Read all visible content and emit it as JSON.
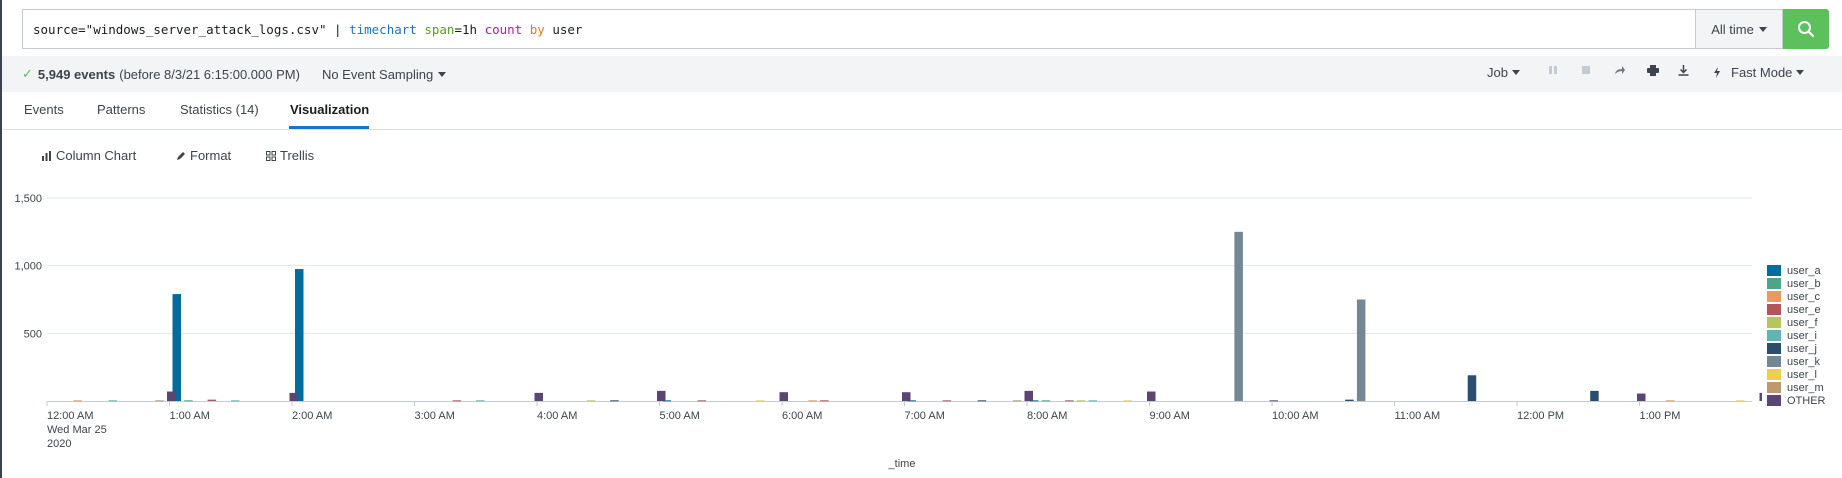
{
  "search": {
    "tokens": [
      {
        "text": "source=\"windows_server_attack_logs.csv\" | ",
        "cls": "tok-plain"
      },
      {
        "text": "timechart",
        "cls": "tok-cmd"
      },
      {
        "text": " ",
        "cls": "tok-plain"
      },
      {
        "text": "span",
        "cls": "tok-arg"
      },
      {
        "text": "=1h ",
        "cls": "tok-plain"
      },
      {
        "text": "count",
        "cls": "tok-fn"
      },
      {
        "text": " ",
        "cls": "tok-plain"
      },
      {
        "text": "by",
        "cls": "tok-kw"
      },
      {
        "text": " user",
        "cls": "tok-plain"
      }
    ],
    "time_range": "All time",
    "search_button_icon": "search-icon"
  },
  "status": {
    "check_icon": "✓",
    "events_count": "5,949 events",
    "events_before": "(before 8/3/21 6:15:00.000 PM)",
    "sampling": "No Event Sampling",
    "job": "Job",
    "mode": "Fast Mode"
  },
  "tabs": [
    "Events",
    "Patterns",
    "Statistics (14)",
    "Visualization"
  ],
  "active_tab": "Visualization",
  "viz_toolbar": {
    "chart_type": "Column Chart",
    "format": "Format",
    "trellis": "Trellis"
  },
  "chart_data": {
    "type": "bar",
    "stacked": false,
    "xlabel": "_time",
    "ylabel": "",
    "ylim": [
      0,
      1500
    ],
    "y_ticks": [
      "500",
      "1,000",
      "1,500"
    ],
    "grid": true,
    "legend_position": "right",
    "x_tick_labels": [
      "12:00 AM",
      "1:00 AM",
      "2:00 AM",
      "3:00 AM",
      "4:00 AM",
      "5:00 AM",
      "6:00 AM",
      "7:00 AM",
      "8:00 AM",
      "9:00 AM",
      "10:00 AM",
      "11:00 AM",
      "12:00 PM",
      "1:00 PM"
    ],
    "x_first_sublabel": [
      "Wed Mar 25",
      "2020"
    ],
    "categories": [
      "12:00 AM",
      "1:00 AM",
      "2:00 AM",
      "3:00 AM",
      "4:00 AM",
      "5:00 AM",
      "6:00 AM",
      "7:00 AM",
      "8:00 AM",
      "9:00 AM",
      "10:00 AM",
      "11:00 AM",
      "12:00 PM",
      "1:00 PM"
    ],
    "series": [
      {
        "name": "user_a",
        "color": "#006d9c",
        "values": [
          0,
          790,
          975,
          0,
          0,
          5,
          0,
          5,
          5,
          0,
          0,
          0,
          0,
          0
        ]
      },
      {
        "name": "user_b",
        "color": "#4fa484",
        "values": [
          0,
          5,
          0,
          0,
          0,
          0,
          0,
          0,
          5,
          0,
          0,
          0,
          0,
          0
        ]
      },
      {
        "name": "user_c",
        "color": "#ec9960",
        "values": [
          5,
          0,
          0,
          0,
          0,
          0,
          5,
          0,
          0,
          0,
          0,
          0,
          0,
          5
        ]
      },
      {
        "name": "user_e",
        "color": "#af575a",
        "values": [
          0,
          10,
          0,
          5,
          0,
          5,
          5,
          5,
          5,
          0,
          0,
          0,
          0,
          0
        ]
      },
      {
        "name": "user_f",
        "color": "#b6c75a",
        "values": [
          0,
          0,
          0,
          0,
          5,
          0,
          0,
          0,
          5,
          0,
          0,
          0,
          0,
          0
        ]
      },
      {
        "name": "user_i",
        "color": "#62b3b2",
        "values": [
          5,
          5,
          0,
          5,
          0,
          0,
          0,
          0,
          5,
          0,
          0,
          0,
          0,
          0
        ]
      },
      {
        "name": "user_j",
        "color": "#294e70",
        "values": [
          0,
          0,
          0,
          0,
          5,
          0,
          0,
          5,
          0,
          0,
          10,
          190,
          75,
          0
        ]
      },
      {
        "name": "user_k",
        "color": "#738795",
        "values": [
          0,
          0,
          0,
          0,
          0,
          0,
          0,
          0,
          0,
          1250,
          750,
          0,
          0,
          0
        ]
      },
      {
        "name": "user_l",
        "color": "#edd051",
        "values": [
          0,
          0,
          0,
          0,
          0,
          5,
          0,
          0,
          5,
          0,
          0,
          0,
          0,
          5
        ]
      },
      {
        "name": "user_m",
        "color": "#bd9872",
        "values": [
          5,
          0,
          0,
          0,
          0,
          0,
          0,
          5,
          0,
          0,
          0,
          0,
          0,
          0
        ]
      },
      {
        "name": "OTHER",
        "color": "#5a4575",
        "values": [
          70,
          60,
          0,
          60,
          75,
          65,
          65,
          75,
          70,
          5,
          0,
          0,
          55,
          60
        ]
      }
    ]
  }
}
